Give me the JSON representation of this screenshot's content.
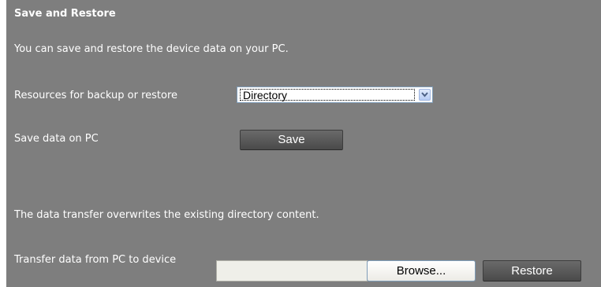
{
  "section": {
    "title": "Save and Restore",
    "intro": "You can save and restore the device data on your PC."
  },
  "resources": {
    "label": "Resources for backup or restore",
    "selected": "Directory"
  },
  "save": {
    "label": "Save data on PC",
    "button": "Save"
  },
  "warning": "The data transfer overwrites the existing directory content.",
  "transfer": {
    "label": "Transfer data from PC to device",
    "file_value": "",
    "browse_button": "Browse...",
    "restore_button": "Restore"
  },
  "colors": {
    "panel_bg": "#7e7e7e",
    "text": "#ffffff",
    "button_bg": "#5a5a5a"
  }
}
